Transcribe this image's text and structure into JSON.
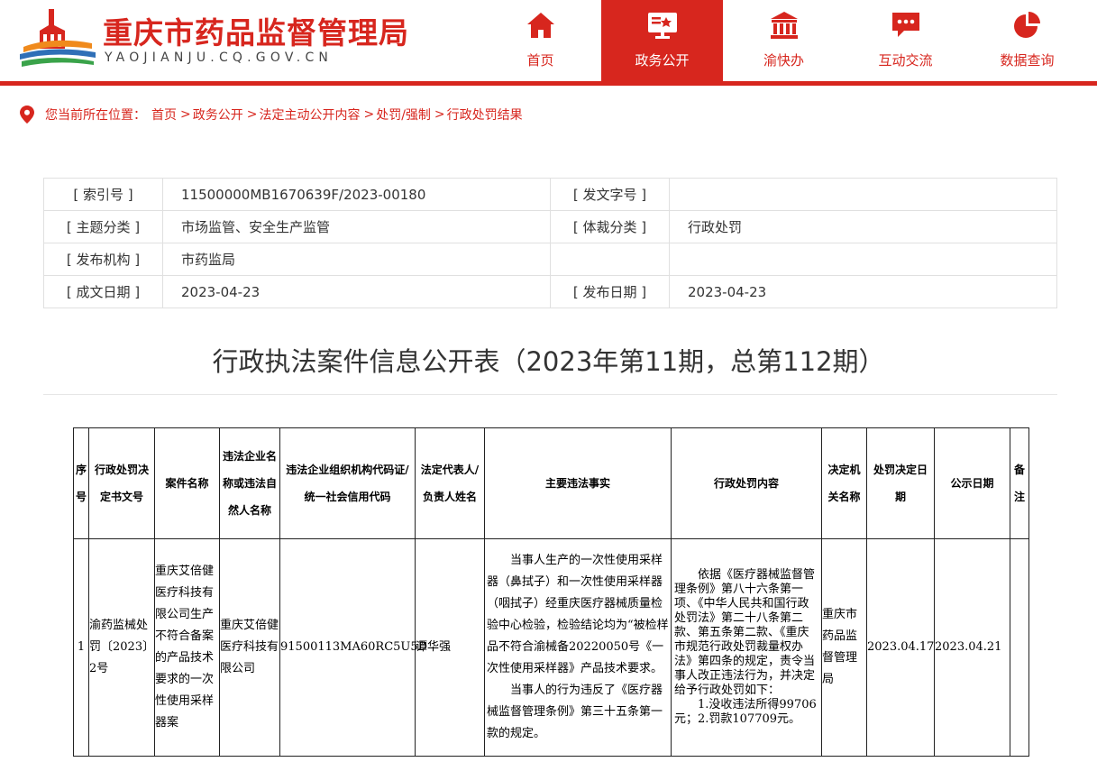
{
  "header": {
    "site_title": "重庆市药品监督管理局",
    "site_domain": "YAOJIANJU.CQ.GOV.CN",
    "brand_color": "#d7261e"
  },
  "nav": [
    {
      "label": "首页",
      "icon": "home-icon",
      "active": false
    },
    {
      "label": "政务公开",
      "icon": "public-affairs-icon",
      "active": true
    },
    {
      "label": "渝快办",
      "icon": "government-building-icon",
      "active": false
    },
    {
      "label": "互动交流",
      "icon": "chat-bubble-icon",
      "active": false
    },
    {
      "label": "数据查询",
      "icon": "pie-chart-icon",
      "active": false
    }
  ],
  "breadcrumb": {
    "prefix": "您当前所在位置：",
    "items": [
      "首页",
      "政务公开",
      "法定主动公开内容",
      "处罚/强制",
      "行政处罚结果"
    ],
    "separator": ">"
  },
  "meta": {
    "rows": [
      {
        "k1": "[ 索引号 ]",
        "v1": "11500000MB1670639F/2023-00180",
        "k2": "[ 发文字号 ]",
        "v2": ""
      },
      {
        "k1": "[ 主题分类 ]",
        "v1": "市场监管、安全生产监管",
        "k2": "[ 体裁分类 ]",
        "v2": "行政处罚"
      },
      {
        "k1": "[ 发布机构 ]",
        "v1": "市药监局",
        "k2": "",
        "v2": ""
      },
      {
        "k1": "[ 成文日期 ]",
        "v1": "2023-04-23",
        "k2": "[ 发布日期 ]",
        "v2": "2023-04-23"
      }
    ]
  },
  "article": {
    "title": "行政执法案件信息公开表（2023年第11期，总第112期）"
  },
  "case_table": {
    "headers": {
      "seq": "序号",
      "decision_no": "行政处罚决定书文号",
      "case_name": "案件名称",
      "violator": "违法企业名称或违法自然人名称",
      "credit_code": "违法企业组织机构代码证/ 统一社会信用代码",
      "legal_rep": "法定代表人/负责人姓名",
      "facts": "主要违法事实",
      "punishment": "行政处罚内容",
      "authority": "决定机关名称",
      "decision_date": "处罚决定日期",
      "publish_date": "公示日期",
      "remark": "备注"
    },
    "rows": [
      {
        "seq": "1",
        "decision_no": "渝药监械处罚〔2023〕2号",
        "case_name": "重庆艾倍健医疗科技有限公司生产不符合备案的产品技术要求的一次性使用采样器案",
        "violator": "重庆艾倍健医疗科技有限公司",
        "credit_code": "91500113MA60RC5U5D",
        "legal_rep": "谭华强",
        "facts_p1": "当事人生产的一次性使用采样器（鼻拭子）和一次性使用采样器（咽拭子）经重庆医疗器械质量检验中心检验，检验结论均为“被检样品不符合渝械备20220050号《一次性使用采样器》产品技术要求。",
        "facts_p2": "当事人的行为违反了《医疗器械监督管理条例》第三十五条第一款的规定。",
        "punishment_p1": "依据《医疗器械监督管理条例》第八十六条第一项、《中华人民共和国行政处罚法》第二十八条第二款、第五条第二款、《重庆市规范行政处罚裁量权办法》第四条的规定，责令当事人改正违法行为，并决定给予行政处罚如下：",
        "punishment_p2": "1.没收违法所得99706元；2.罚款107709元。",
        "authority": "重庆市药品监督管理局",
        "decision_date": "2023.04.17",
        "publish_date": "2023.04.21",
        "remark": ""
      }
    ]
  }
}
